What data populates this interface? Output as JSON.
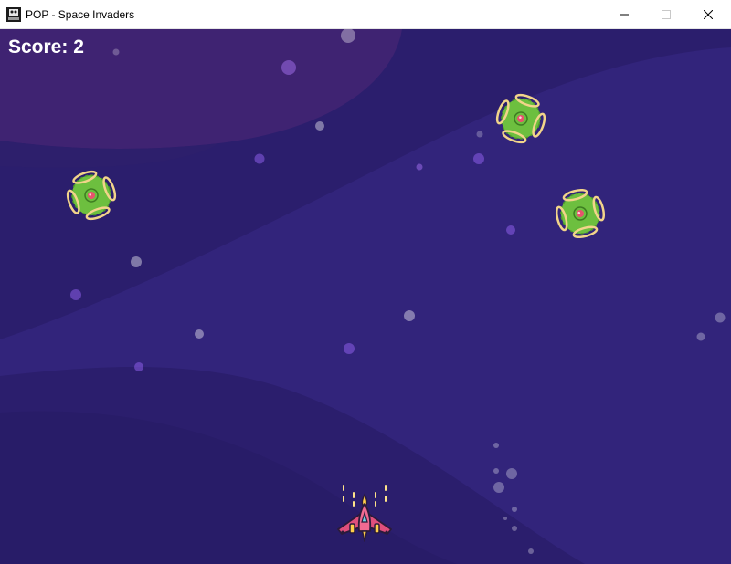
{
  "window": {
    "title": "POP - Space Invaders",
    "controls": [
      "minimize",
      "maximize",
      "close"
    ]
  },
  "hud": {
    "score_label": "Score:",
    "score_value": "2"
  },
  "game": {
    "invaders": [
      {
        "id": "invader-1",
        "icon": "green-alien-ufo"
      },
      {
        "id": "invader-2",
        "icon": "green-alien-ufo"
      },
      {
        "id": "invader-3",
        "icon": "green-alien-ufo"
      }
    ],
    "player": {
      "icon": "pink-spaceship"
    }
  },
  "colors": {
    "background": "#2b1e6d",
    "background_light": "#35267f",
    "background_top": "#3e2374",
    "invader_body": "#6dbf3f",
    "invader_ring": "#f2d48a",
    "ship_body": "#e04f7c",
    "ship_flame": "#ffcf4a"
  }
}
